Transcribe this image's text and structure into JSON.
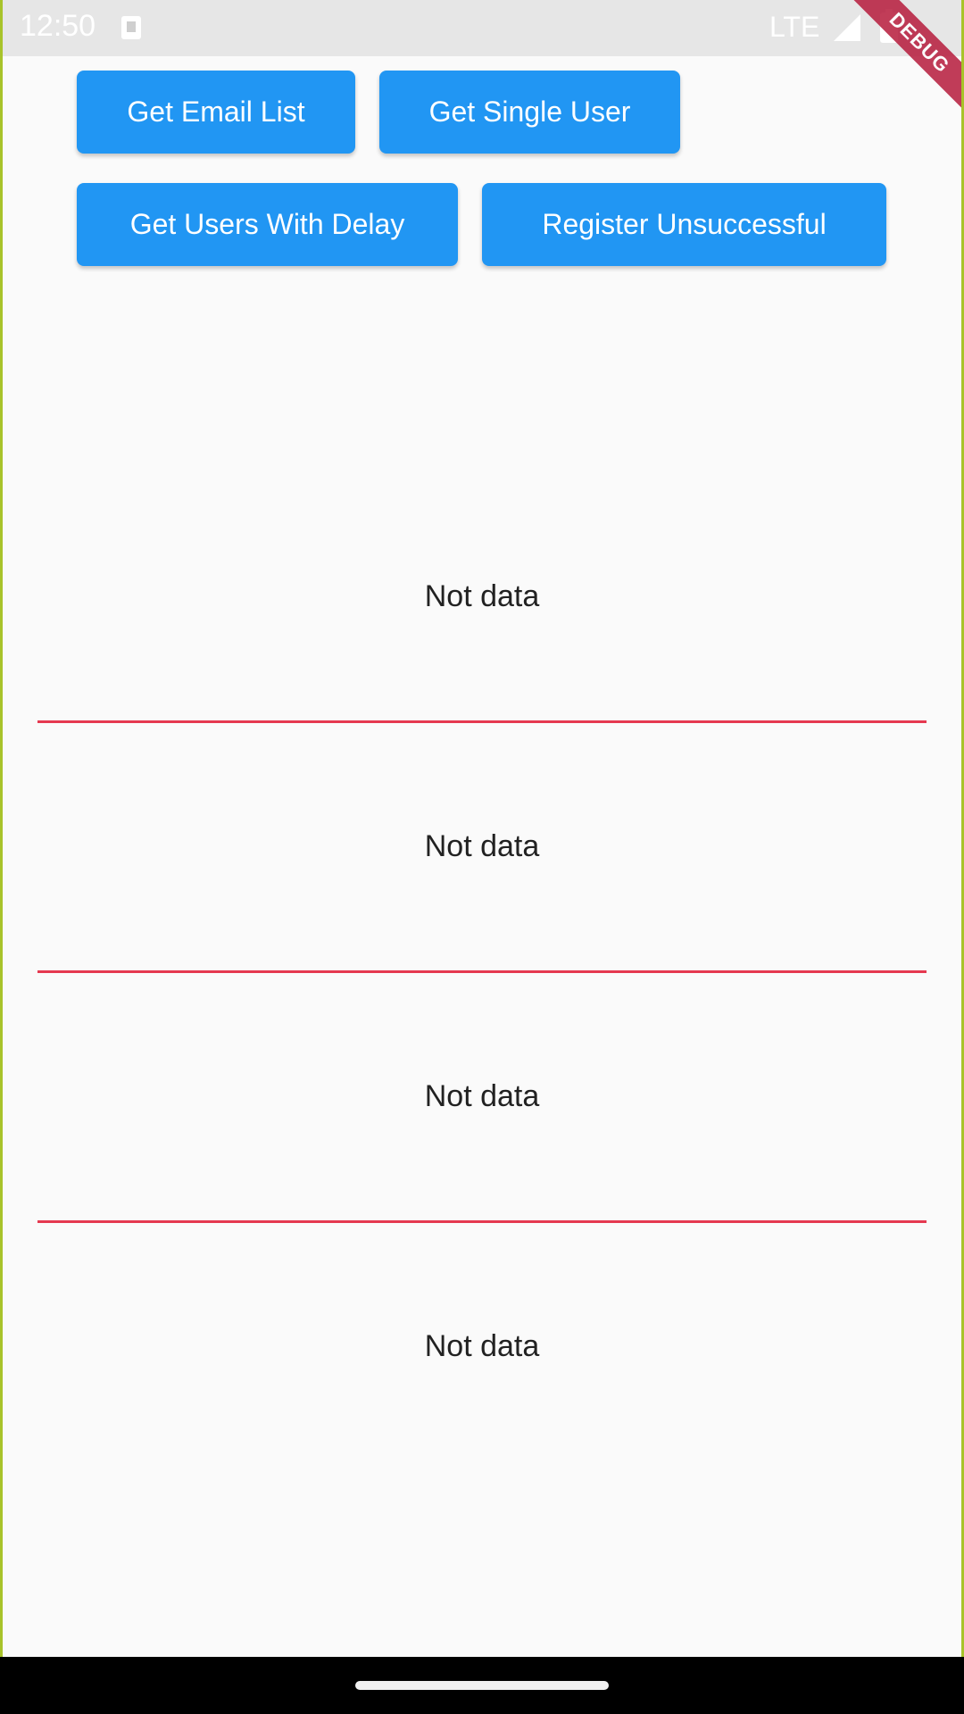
{
  "status_bar": {
    "time": "12:50",
    "network": "LTE",
    "icons": [
      "notification-icon",
      "signal-icon",
      "battery-icon"
    ]
  },
  "debug_banner": "DEBUG",
  "buttons": {
    "get_email_list": "Get Email List",
    "get_single_user": "Get Single User",
    "get_users_with_delay": "Get Users With Delay",
    "register_unsuccessful": "Register Unsuccessful"
  },
  "list": {
    "items": [
      {
        "text": "Not data"
      },
      {
        "text": "Not data"
      },
      {
        "text": "Not data"
      },
      {
        "text": "Not data"
      }
    ]
  },
  "colors": {
    "button": "#2196f3",
    "divider": "#e53950",
    "background": "#fafafa"
  }
}
